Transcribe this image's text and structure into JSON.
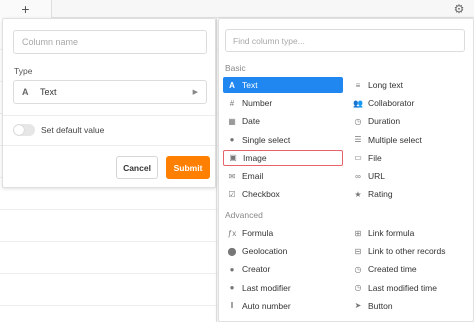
{
  "toolbar": {
    "add_label": "+",
    "settings_icon": "gear-icon"
  },
  "column_form": {
    "name_placeholder": "Column name",
    "type_label": "Type",
    "type_value": "Text",
    "type_icon": "text-icon",
    "default_toggle_label": "Set default value",
    "cancel_label": "Cancel",
    "submit_label": "Submit",
    "submit_color": "#ff8000"
  },
  "type_picker": {
    "search_placeholder": "Find column type...",
    "basic_label": "Basic",
    "advanced_label": "Advanced",
    "selected_color": "#1f87ef",
    "highlight_color": "#e8646c",
    "basic": [
      {
        "label": "Text",
        "icon": "A",
        "name": "text"
      },
      {
        "label": "Long text",
        "icon": "long-text",
        "name": "long-text"
      },
      {
        "label": "Number",
        "icon": "#",
        "name": "number"
      },
      {
        "label": "Collaborator",
        "icon": "users",
        "name": "collaborator"
      },
      {
        "label": "Date",
        "icon": "calendar",
        "name": "date"
      },
      {
        "label": "Duration",
        "icon": "clock",
        "name": "duration"
      },
      {
        "label": "Single select",
        "icon": "dot",
        "name": "single-select"
      },
      {
        "label": "Multiple select",
        "icon": "list",
        "name": "multiple-select"
      },
      {
        "label": "Image",
        "icon": "image",
        "name": "image"
      },
      {
        "label": "File",
        "icon": "file",
        "name": "file"
      },
      {
        "label": "Email",
        "icon": "mail",
        "name": "email"
      },
      {
        "label": "URL",
        "icon": "link",
        "name": "url"
      },
      {
        "label": "Checkbox",
        "icon": "check",
        "name": "checkbox"
      },
      {
        "label": "Rating",
        "icon": "star",
        "name": "rating"
      }
    ],
    "advanced": [
      {
        "label": "Formula",
        "icon": "fx",
        "name": "formula"
      },
      {
        "label": "Link formula",
        "icon": "link-formula",
        "name": "link-formula"
      },
      {
        "label": "Geolocation",
        "icon": "pin",
        "name": "geolocation"
      },
      {
        "label": "Link to other records",
        "icon": "link-records",
        "name": "link-to-other-records"
      },
      {
        "label": "Creator",
        "icon": "person",
        "name": "creator"
      },
      {
        "label": "Created time",
        "icon": "clock",
        "name": "created-time"
      },
      {
        "label": "Last modifier",
        "icon": "person",
        "name": "last-modifier"
      },
      {
        "label": "Last modified time",
        "icon": "clock",
        "name": "last-modified-time"
      },
      {
        "label": "Auto number",
        "icon": "bars",
        "name": "auto-number"
      },
      {
        "label": "Button",
        "icon": "cursor",
        "name": "button"
      }
    ],
    "selected_item": "text",
    "highlighted_item": "image"
  }
}
